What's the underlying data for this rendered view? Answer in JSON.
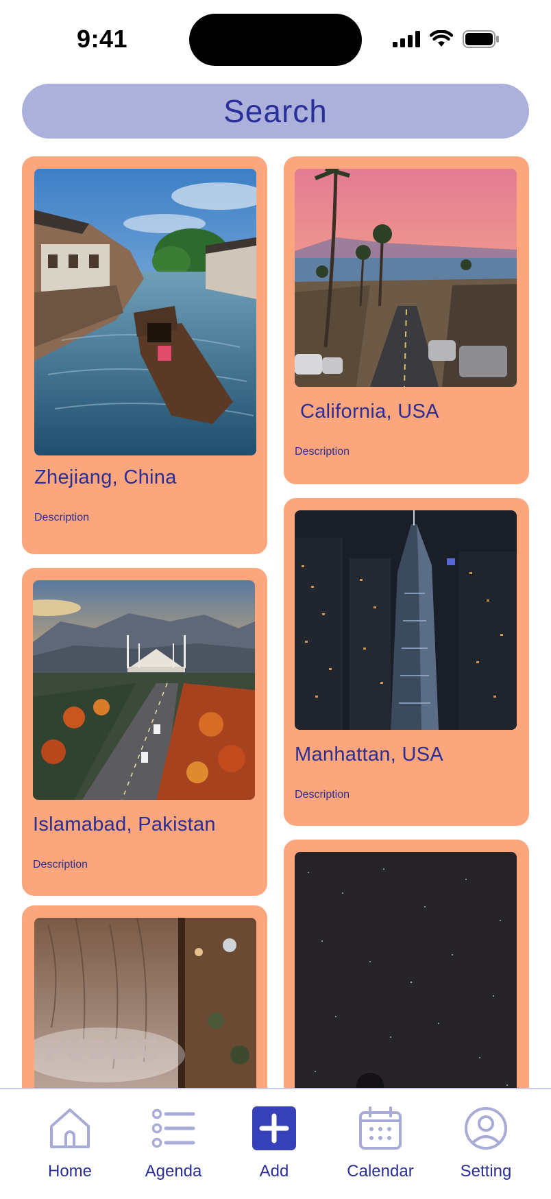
{
  "status_bar": {
    "time": "9:41"
  },
  "search": {
    "label": "Search"
  },
  "cards": [
    {
      "title": "Zhejiang, China",
      "description": "Description",
      "image": "canal-boat-photo"
    },
    {
      "title": "California, USA",
      "description": "Description",
      "image": "palm-street-sunset-photo"
    },
    {
      "title": "Islamabad, Pakistan",
      "description": "Description",
      "image": "mosque-highway-photo"
    },
    {
      "title": "Manhattan, USA",
      "description": "Description",
      "image": "night-skyscraper-photo"
    },
    {
      "title": "",
      "description": "",
      "image": "wooden-door-public-photo",
      "image_text": "PUBLIC"
    },
    {
      "title": "",
      "description": "",
      "image": "starry-sky-photo"
    }
  ],
  "tabbar": {
    "items": [
      {
        "label": "Home",
        "icon": "home-icon",
        "active": false
      },
      {
        "label": "Agenda",
        "icon": "list-icon",
        "active": false
      },
      {
        "label": "Add",
        "icon": "plus-icon",
        "active": true
      },
      {
        "label": "Calendar",
        "icon": "calendar-icon",
        "active": false
      },
      {
        "label": "Setting",
        "icon": "profile-icon",
        "active": false
      }
    ]
  },
  "colors": {
    "card_bg": "#fca67d",
    "search_bg": "#acb1db",
    "accent": "#2b2e96",
    "add_button": "#3640b8",
    "icon_inactive": "#a7abd6"
  }
}
